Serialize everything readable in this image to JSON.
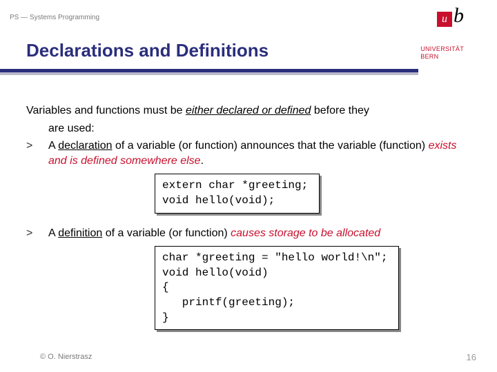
{
  "header": {
    "course": "PS — Systems Programming"
  },
  "logo": {
    "u": "u",
    "b": "b",
    "uni_line1": "UNIVERSITÄT",
    "uni_line2": "BERN"
  },
  "title": "Declarations and Definitions",
  "intro": {
    "pre": "Variables and functions must be ",
    "em": "either declared or defined",
    "post": " before they"
  },
  "intro_line2": "are used:",
  "bullets": [
    {
      "sym": ">",
      "t1": "A ",
      "u1": "declaration",
      "t2": " of a variable (or function) announces that the variable (function) ",
      "em": "exists and is defined somewhere else",
      "t3": "."
    },
    {
      "sym": ">",
      "t1": "A ",
      "u1": "definition",
      "t2": " of a variable (or function) ",
      "em": "causes storage to be allocated",
      "t3": ""
    }
  ],
  "code1": "extern char *greeting;\nvoid hello(void);",
  "code2": "char *greeting = \"hello world!\\n\";\nvoid hello(void)\n{\n   printf(greeting);\n}",
  "footer": {
    "copyright": "© O. Nierstrasz",
    "page": "16"
  }
}
